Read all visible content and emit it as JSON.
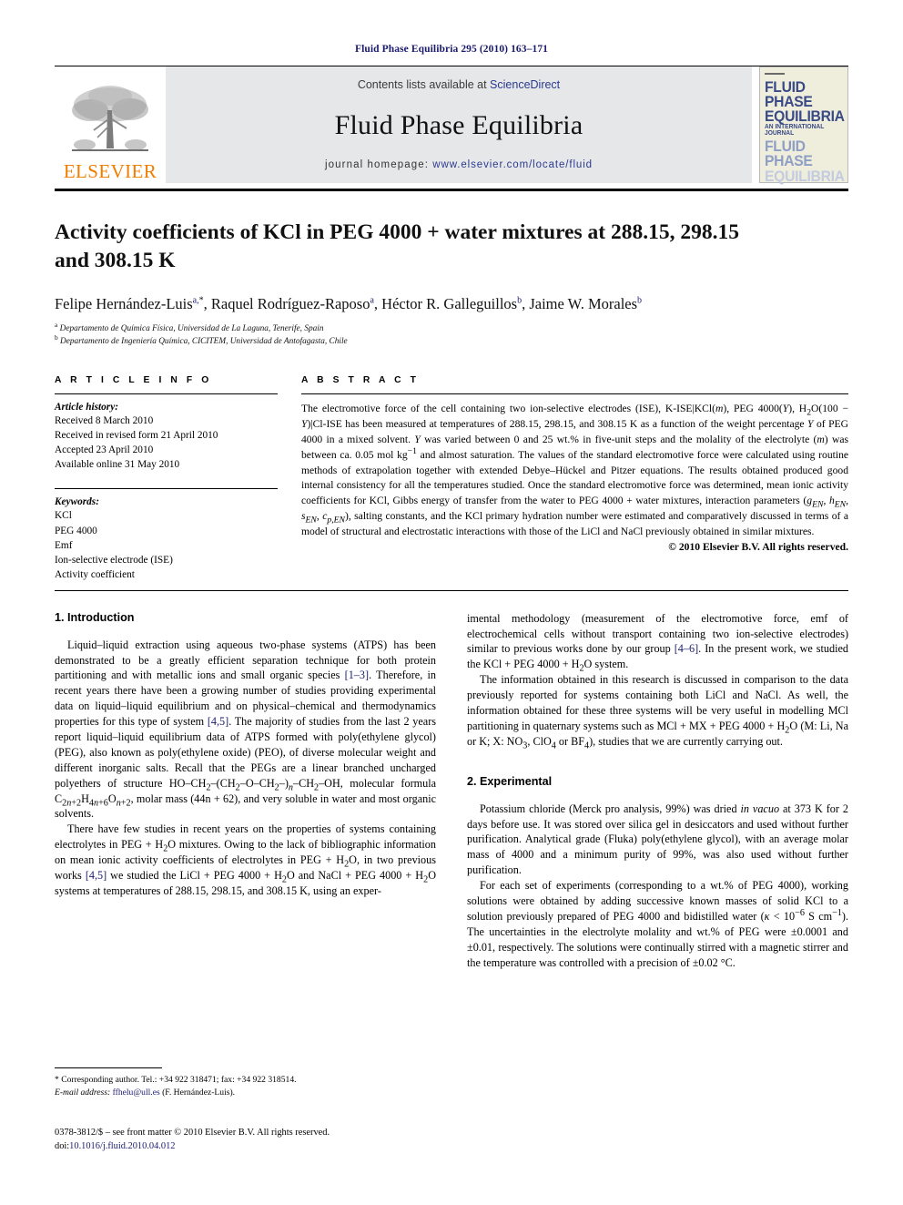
{
  "running_head": "Fluid Phase Equilibria 295 (2010) 163–171",
  "masthead": {
    "contents_prefix": "Contents lists available at ",
    "sciencedirect": "ScienceDirect",
    "journal_title": "Fluid Phase Equilibria",
    "homepage_prefix": "journal homepage: ",
    "homepage_url": "www.elsevier.com/locate/fluid",
    "publisher_wordmark": "ELSEVIER",
    "cover": {
      "line1": "FLUID PHASE",
      "line2": "EQUILIBRIA",
      "line3": "AN INTERNATIONAL JOURNAL",
      "line4": "FLUID PHASE",
      "line5": "EQUILIBRIA"
    }
  },
  "article": {
    "title": "Activity coefficients of KCl in PEG 4000 + water mixtures at 288.15, 298.15 and 308.15 K",
    "authors_html": "Felipe Hernández-Luis<sup>a,</sup><sup class=\"plain\">*</sup>, Raquel Rodríguez-Raposo<sup>a</sup>, Héctor R. Galleguillos<sup>b</sup>, Jaime W. Morales<sup>b</sup>",
    "affiliation_a": "Departamento de Química Física, Universidad de La Laguna, Tenerife, Spain",
    "affiliation_b": "Departamento de Ingeniería Química, CICITEM, Universidad de Antofagasta, Chile"
  },
  "article_info": {
    "heading": "A R T I C L E  I N F O",
    "history_label": "Article history:",
    "history": [
      "Received 8 March 2010",
      "Received in revised form 21 April 2010",
      "Accepted 23 April 2010",
      "Available online 31 May 2010"
    ],
    "keywords_label": "Keywords:",
    "keywords": [
      "KCl",
      "PEG 4000",
      "Emf",
      "Ion-selective electrode (ISE)",
      "Activity coefficient"
    ]
  },
  "abstract": {
    "heading": "A B S T R A C T",
    "body_html": "The electromotive force of the cell containing two ion-selective electrodes (ISE), K-ISE|KCl(<i>m</i>), PEG 4000(<i>Y</i>), H<sub>2</sub>O(100 − <i>Y</i>)|Cl-ISE has been measured at temperatures of 288.15, 298.15, and 308.15 K as a function of the weight percentage <i>Y</i> of PEG 4000 in a mixed solvent. <i>Y</i> was varied between 0 and 25 wt.% in five-unit steps and the molality of the electrolyte (<i>m</i>) was between ca. 0.05 mol kg<sup>−1</sup> and almost saturation. The values of the standard electromotive force were calculated using routine methods of extrapolation together with extended Debye–Hückel and Pitzer equations. The results obtained produced good internal consistency for all the temperatures studied. Once the standard electromotive force was determined, mean ionic activity coefficients for KCl, Gibbs energy of transfer from the water to PEG 4000 + water mixtures, interaction parameters (<i>g<sub>EN</sub></i>, <i>h<sub>EN</sub></i>, <i>s<sub>EN</sub></i>, <i>c<sub>p,EN</sub></i>), salting constants, and the KCl primary hydration number were estimated and comparatively discussed in terms of a model of structural and electrostatic interactions with those of the LiCl and NaCl previously obtained in similar mixtures.",
    "copyright": "© 2010 Elsevier B.V. All rights reserved."
  },
  "sections": {
    "introduction": {
      "number_title": "1.  Introduction",
      "p1_html": "Liquid–liquid extraction using aqueous two-phase systems (ATPS) has been demonstrated to be a greatly efficient separation technique for both protein partitioning and with metallic ions and small organic species <span class=\"ref\">[1–3]</span>. Therefore, in recent years there have been a growing number of studies providing experimental data on liquid–liquid equilibrium and on physical–chemical and thermodynamics properties for this type of system <span class=\"ref\">[4,5]</span>. The majority of studies from the last 2 years report liquid–liquid equilibrium data of ATPS formed with poly(ethylene glycol) (PEG), also known as poly(ethylene oxide) (PEO), of diverse molecular weight and different inorganic salts. Recall that the PEGs are a linear branched uncharged polyethers of structure HO–CH<sub>2</sub>–(CH<sub>2</sub>–O–CH<sub>2</sub>–)<sub><i>n</i></sub>–CH<sub>2</sub>–OH, molecular formula C<sub>2<i>n</i>+2</sub>H<sub>4<i>n</i>+6</sub>O<sub><i>n</i>+2</sub>, molar mass (44n + 62), and very soluble in water and most organic solvents.",
      "p2_html": "There have few studies in recent years on the properties of systems containing electrolytes in PEG + H<sub>2</sub>O mixtures. Owing to the lack of bibliographic information on mean ionic activity coefficients of electrolytes in PEG + H<sub>2</sub>O, in two previous works <span class=\"ref\">[4,5]</span> we studied the LiCl + PEG 4000 + H<sub>2</sub>O and NaCl + PEG 4000 + H<sub>2</sub>O systems at temperatures of 288.15, 298.15, and 308.15 K, using an exper-",
      "p3_html": "imental methodology (measurement of the electromotive force, emf of electrochemical cells without transport containing two ion-selective electrodes) similar to previous works done by our group <span class=\"ref\">[4–6]</span>. In the present work, we studied the KCl + PEG 4000 + H<sub>2</sub>O system.",
      "p4_html": "The information obtained in this research is discussed in comparison to the data previously reported for systems containing both LiCl and NaCl. As well, the information obtained for these three systems will be very useful in modelling MCl partitioning in quaternary systems such as MCl + MX + PEG 4000 + H<sub>2</sub>O (M: Li, Na or K; X: NO<sub>3</sub>, ClO<sub>4</sub> or BF<sub>4</sub>), studies that we are currently carrying out."
    },
    "experimental": {
      "number_title": "2.  Experimental",
      "p1_html": "Potassium chloride (Merck pro analysis, 99%) was dried <i>in vacuo</i> at 373 K for 2 days before use. It was stored over silica gel in desiccators and used without further purification. Analytical grade (Fluka) poly(ethylene glycol), with an average molar mass of 4000 and a minimum purity of 99%, was also used without further purification.",
      "p2_html": "For each set of experiments (corresponding to a wt.% of PEG 4000), working solutions were obtained by adding successive known masses of solid KCl to a solution previously prepared of PEG 4000 and bidistilled water (<i>κ</i> &lt; 10<sup>−6</sup> S cm<sup>−1</sup>). The uncertainties in the electrolyte molality and wt.% of PEG were ±0.0001 and ±0.01, respectively. The solutions were continually stirred with a magnetic stirrer and the temperature was controlled with a precision of ±0.02 °C."
    }
  },
  "footnote": {
    "corresponding_html": "* Corresponding author. Tel.: +34 922 318471; fax: +34 922 318514.",
    "email_label": "E-mail address:",
    "email": "ffhelu@ull.es",
    "email_attrib": "(F. Hernández-Luis)."
  },
  "imprint": {
    "issn_line": "0378-3812/$ – see front matter © 2010 Elsevier B.V. All rights reserved.",
    "doi_label": "doi:",
    "doi": "10.1016/j.fluid.2010.04.012"
  },
  "colors": {
    "link_navy": "#1a1a6e",
    "elsevier_orange": "#F07D00",
    "panel_grey": "#e6e7e9",
    "cover_cream": "#efeedd"
  }
}
